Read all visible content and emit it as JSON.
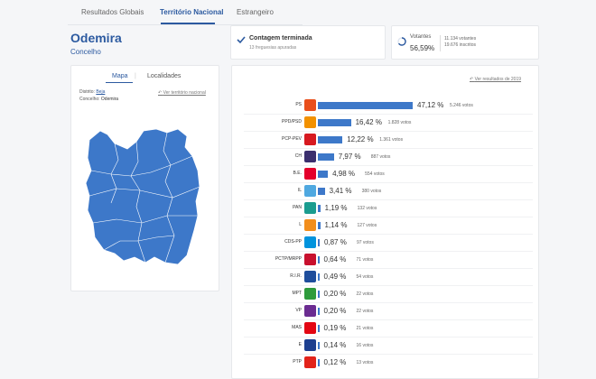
{
  "tabs": [
    {
      "label": "Resultados Globais",
      "active": false
    },
    {
      "label": "Território Nacional",
      "active": true
    },
    {
      "label": "Estrangeiro",
      "active": false
    }
  ],
  "place": {
    "title": "Odemira",
    "subtitle": "Concelho"
  },
  "status": {
    "title": "Contagem terminada",
    "subtitle": "13 freguesias apuradas"
  },
  "votes": {
    "label": "Votantes",
    "percent": "56,59%",
    "count": "11.134 votantes",
    "registered": "19.676 inscritos"
  },
  "map_panel": {
    "tab_map": "Mapa",
    "tab_sep": "|",
    "tab_localities": "Localidades",
    "district_label": "Distrito:",
    "district_value": "Beja",
    "council_label": "Concelho:",
    "council_value": "Odemira",
    "back_link": "Ver território nacional"
  },
  "results": {
    "prev_link": "Ver resultados de 2019",
    "parties": [
      {
        "party": "PS",
        "pct": "47,12 %",
        "votes": "5.246 votos",
        "share": 47.12,
        "color": "#e94e1b"
      },
      {
        "party": "PPD/PSD",
        "pct": "16,42 %",
        "votes": "1.828 votos",
        "share": 16.42,
        "color": "#f29100"
      },
      {
        "party": "PCP-PEV",
        "pct": "12,22 %",
        "votes": "1.361 votos",
        "share": 12.22,
        "color": "#d71920"
      },
      {
        "party": "CH",
        "pct": "7,97 %",
        "votes": "887 votos",
        "share": 7.97,
        "color": "#3b2f6e"
      },
      {
        "party": "B.E.",
        "pct": "4,98 %",
        "votes": "554 votos",
        "share": 4.98,
        "color": "#e4002b"
      },
      {
        "party": "IL",
        "pct": "3,41 %",
        "votes": "380 votos",
        "share": 3.41,
        "color": "#4fa8e0"
      },
      {
        "party": "PAN",
        "pct": "1,19 %",
        "votes": "132 votos",
        "share": 1.19,
        "color": "#1a9c8f"
      },
      {
        "party": "L",
        "pct": "1,14 %",
        "votes": "127 votos",
        "share": 1.14,
        "color": "#f28e1c"
      },
      {
        "party": "CDS-PP",
        "pct": "0,87 %",
        "votes": "97 votos",
        "share": 0.87,
        "color": "#0093dd"
      },
      {
        "party": "PCTP/MRPP",
        "pct": "0,64 %",
        "votes": "71 votos",
        "share": 0.64,
        "color": "#c8102e"
      },
      {
        "party": "R.I.R.",
        "pct": "0,49 %",
        "votes": "54 votos",
        "share": 0.49,
        "color": "#1f4e9c"
      },
      {
        "party": "MPT",
        "pct": "0,20 %",
        "votes": "22 votos",
        "share": 0.2,
        "color": "#2e9b3c"
      },
      {
        "party": "VP",
        "pct": "0,20 %",
        "votes": "22 votos",
        "share": 0.2,
        "color": "#6b2c91"
      },
      {
        "party": "MAS",
        "pct": "0,19 %",
        "votes": "21 votos",
        "share": 0.19,
        "color": "#e30613"
      },
      {
        "party": "E",
        "pct": "0,14 %",
        "votes": "16 votos",
        "share": 0.14,
        "color": "#1d3f8f"
      },
      {
        "party": "PTP",
        "pct": "0,12 %",
        "votes": "13 votos",
        "share": 0.12,
        "color": "#e2231a"
      }
    ]
  }
}
